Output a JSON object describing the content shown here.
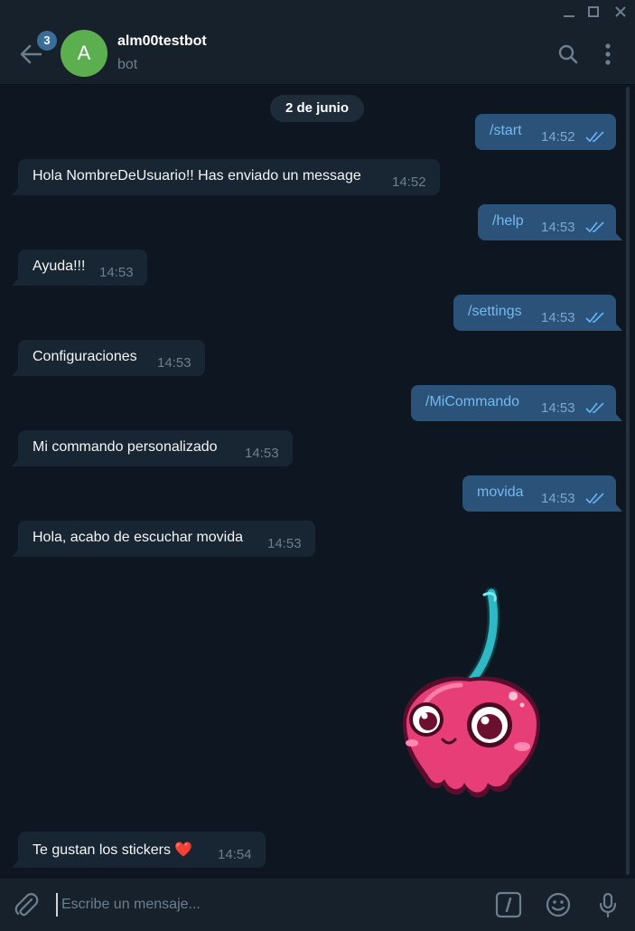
{
  "window": {
    "controls": [
      "minimize-icon",
      "maximize-icon",
      "close-icon"
    ]
  },
  "header": {
    "unread_badge": "3",
    "avatar_letter": "A",
    "title": "alm00testbot",
    "status": "bot",
    "icons": [
      "back-arrow-icon",
      "search-icon",
      "more-vertical-icon"
    ]
  },
  "chat": {
    "date_label": "2 de junio",
    "messages": [
      {
        "direction": "out",
        "text": "/start",
        "time": "14:52",
        "read": true
      },
      {
        "direction": "in",
        "text": "Hola NombreDeUsuario!! Has enviado un message",
        "time": "14:52"
      },
      {
        "direction": "out",
        "text": "/help",
        "time": "14:53",
        "read": true
      },
      {
        "direction": "in",
        "text": "Ayuda!!!",
        "time": "14:53"
      },
      {
        "direction": "out",
        "text": "/settings",
        "time": "14:53",
        "read": true
      },
      {
        "direction": "in",
        "text": "Configuraciones",
        "time": "14:53"
      },
      {
        "direction": "out",
        "text": "/MiCommando",
        "time": "14:53",
        "read": true
      },
      {
        "direction": "in",
        "text": "Mi commando personalizado",
        "time": "14:53"
      },
      {
        "direction": "out",
        "text": "movida",
        "time": "14:53",
        "read": true
      },
      {
        "direction": "in",
        "text": "Hola, acabo de escuchar movida",
        "time": "14:53"
      },
      {
        "direction": "in",
        "type": "sticker",
        "sticker": "cherry-sticker"
      },
      {
        "direction": "in",
        "text": "Te gustan los stickers ❤️",
        "time": "14:54"
      }
    ]
  },
  "composer": {
    "placeholder": "Escribe un mensaje...",
    "icons": [
      "attach-icon",
      "bot-commands-icon",
      "emoji-icon",
      "microphone-icon"
    ]
  },
  "colors": {
    "background": "#0e1621",
    "panel": "#17212b",
    "incoming_bubble": "#182533",
    "outgoing_bubble": "#2b5278",
    "avatar": "#5caf4e",
    "accent": "#6ab3f3"
  }
}
